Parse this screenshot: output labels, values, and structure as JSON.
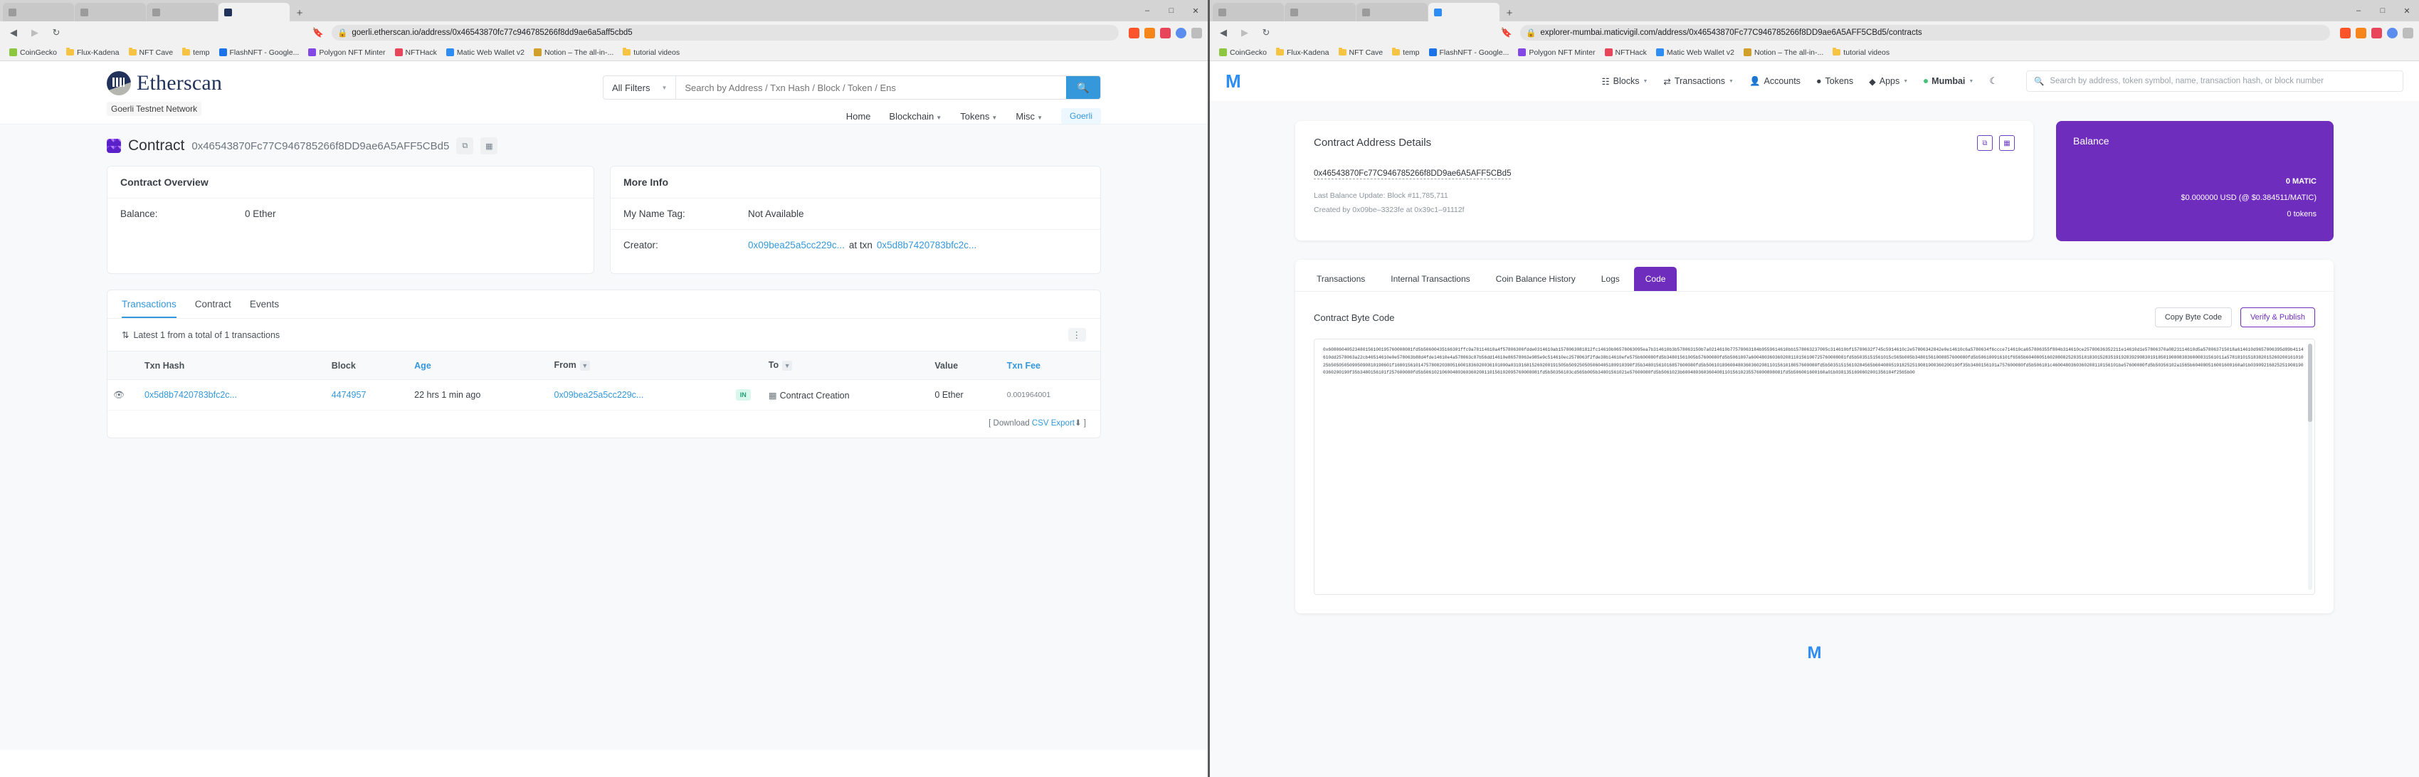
{
  "left_browser": {
    "tabs": [
      {
        "label": "",
        "color": "#8e8e8e"
      },
      {
        "label": "",
        "color": "#8e8e8e"
      },
      {
        "label": "",
        "color": "#8e8e8e"
      },
      {
        "label": "",
        "color": "#8e8e8e"
      }
    ],
    "url": "goerli.etherscan.io/address/0x46543870fc77c946785266f8dd9ae6a5aff5cbd5",
    "lock_icon": "lock-icon",
    "back_icon": "back-arrow-icon",
    "forward_icon": "forward-arrow-icon",
    "reload_icon": "reload-icon",
    "bookmark_star_icon": "bookmark-icon",
    "bookmarks": [
      {
        "label": "CoinGecko",
        "type": "site",
        "color": "#8dc63f"
      },
      {
        "label": "Flux-Kadena",
        "type": "folder"
      },
      {
        "label": "NFT Cave",
        "type": "folder"
      },
      {
        "label": "temp",
        "type": "folder"
      },
      {
        "label": "FlashNFT - Google...",
        "type": "site",
        "color": "#1a73e8"
      },
      {
        "label": "Polygon NFT Minter",
        "type": "site",
        "color": "#8247e5"
      },
      {
        "label": "NFTHack",
        "type": "site",
        "color": "#e8455b"
      },
      {
        "label": "Matic Web Wallet v2",
        "type": "site",
        "color": "#2e8df5"
      },
      {
        "label": "Notion – The all-in-...",
        "type": "site",
        "color": "#d0a02a"
      },
      {
        "label": "tutorial videos",
        "type": "folder"
      }
    ]
  },
  "etherscan": {
    "brand": "Etherscan",
    "network_badge": "Goerli Testnet Network",
    "search": {
      "filter_label": "All Filters",
      "placeholder": "Search by Address / Txn Hash / Block / Token / Ens",
      "value": "",
      "button_icon": "search-icon"
    },
    "nav": [
      {
        "label": "Home",
        "has_caret": false
      },
      {
        "label": "Blockchain",
        "has_caret": true
      },
      {
        "label": "Tokens",
        "has_caret": true
      },
      {
        "label": "Misc",
        "has_caret": true
      }
    ],
    "network_pill": "Goerli",
    "page": {
      "kind_label": "Contract",
      "address": "0x46543870Fc77C946785266f8DD9ae6A5AFF5CBd5",
      "copy_icon": "copy-icon",
      "qr_icon": "qr-code-icon"
    },
    "contract_overview": {
      "title": "Contract Overview",
      "rows": [
        {
          "label": "Balance:",
          "value": "0 Ether"
        }
      ]
    },
    "more_info": {
      "title": "More Info",
      "rows": [
        {
          "label": "My Name Tag:",
          "value": "Not Available",
          "link": false
        },
        {
          "label": "Creator:",
          "value": "0x09bea25a5cc229c...",
          "mid": "at txn",
          "value2": "0x5d8b7420783bfc2c...",
          "link": true
        }
      ]
    },
    "tabs": [
      {
        "label": "Transactions",
        "active": true
      },
      {
        "label": "Contract",
        "active": false
      },
      {
        "label": "Events",
        "active": false
      }
    ],
    "subbar": {
      "sort_icon": "sort-icon",
      "text": "Latest 1 from a total of 1 transactions",
      "kebab_icon": "kebab-menu-icon"
    },
    "table": {
      "columns": [
        "",
        "Txn Hash",
        "Block",
        "Age",
        "From",
        "",
        "To",
        "Value",
        "Txn Fee"
      ],
      "sortable_columns": [
        "Age",
        "Txn Fee"
      ],
      "filter_columns": [
        "From",
        "To"
      ],
      "rows": [
        {
          "eye_icon": "eye-icon",
          "txn_hash": "0x5d8b7420783bfc2c...",
          "block": "4474957",
          "age": "22 hrs 1 min ago",
          "from": "0x09bea25a5cc229c...",
          "direction": "IN",
          "to_icon": "contract-icon",
          "to": "Contract Creation",
          "value": "0 Ether",
          "txn_fee": "0.001964001"
        }
      ]
    },
    "footer": {
      "prefix": "[ Download ",
      "link": "CSV Export",
      "icon": "download-icon",
      "suffix": " ]"
    }
  },
  "right_browser": {
    "url": "explorer-mumbai.maticvigil.com/address/0x46543870Fc77C946785266f8DD9ae6A5AFF5CBd5/contracts",
    "lock_icon": "lock-icon",
    "bookmarks": [
      {
        "label": "CoinGecko",
        "type": "site",
        "color": "#8dc63f"
      },
      {
        "label": "Flux-Kadena",
        "type": "folder"
      },
      {
        "label": "NFT Cave",
        "type": "folder"
      },
      {
        "label": "temp",
        "type": "folder"
      },
      {
        "label": "FlashNFT - Google...",
        "type": "site",
        "color": "#1a73e8"
      },
      {
        "label": "Polygon NFT Minter",
        "type": "site",
        "color": "#8247e5"
      },
      {
        "label": "NFTHack",
        "type": "site",
        "color": "#e8455b"
      },
      {
        "label": "Matic Web Wallet v2",
        "type": "site",
        "color": "#2e8df5"
      },
      {
        "label": "Notion – The all-in-...",
        "type": "site",
        "color": "#d0a02a"
      },
      {
        "label": "tutorial videos",
        "type": "folder"
      }
    ]
  },
  "polygonscan": {
    "logo": "M",
    "nav": [
      {
        "label": "Blocks",
        "icon": "blocks-icon",
        "caret": true
      },
      {
        "label": "Transactions",
        "icon": "transactions-icon",
        "caret": true
      },
      {
        "label": "Accounts",
        "icon": "accounts-icon",
        "caret": false
      },
      {
        "label": "Tokens",
        "icon": "tokens-icon",
        "caret": false
      },
      {
        "label": "Apps",
        "icon": "apps-icon",
        "caret": true
      },
      {
        "label": "Mumbai",
        "icon": "network-dot-icon",
        "caret": true
      }
    ],
    "theme_icon": "moon-icon",
    "search": {
      "placeholder": "Search by address, token symbol, name, transaction hash, or block number",
      "icon": "search-icon"
    },
    "details": {
      "title": "Contract Address Details",
      "copy_icon": "copy-icon",
      "qr_icon": "qr-code-icon",
      "address": "0x46543870Fc77C946785266f8DD9ae6A5AFF5CBd5",
      "last_balance_update": "Last Balance Update: Block #11,785,711",
      "created_by": "Created by 0x09be–3323fe at 0x39c1–91112f"
    },
    "balance": {
      "title": "Balance",
      "amount": "0 MATIC",
      "usd": "$0.000000 USD (@ $0.384511/MATIC)",
      "tokens": "0 tokens",
      "bg_color": "#6f2dbd"
    },
    "tabs": [
      {
        "label": "Transactions",
        "active": false
      },
      {
        "label": "Internal Transactions",
        "active": false
      },
      {
        "label": "Coin Balance History",
        "active": false
      },
      {
        "label": "Logs",
        "active": false
      },
      {
        "label": "Code",
        "active": true
      }
    ],
    "code_panel": {
      "title": "Contract Byte Code",
      "copy_button": "Copy Byte Code",
      "verify_button": "Verify & Publish",
      "bytecode": "0x60806040523480156100195760008081fd5b50600435166301ffc9a78114610a4f57806306fdde0314610ab1578063081812fc14610b06578063095ea7b314610b3b578063150b7a0214610b77578063184b9559614610bb1578063237005c314610bf15780632f745c5914610c2e57806342842e0e14610c6a5780634f6ccce714610ca657806355f804b314610ce25780636352211e14610d1e57806370a0823114610d5a578063715018a614610d9657806395d89b4114610dd2578063a22cb46514610e0e578063b88d4fde14610e4a578063c87b56dd14610e86578063e985e9c514610ec2578063f2fde38b14610efe575b600080fd5b34801561005b57600080fd5b5061007a600480360360208110156100725760008081fd5b5035151561015c565b005b34801561008857600080fd5b506100916101f6565b604080516020808252835181830152835191928392908301918501908083836000831561011a5781810151838201526020016101025b50505050905090810190601f1680156101475780820380516001836020036101000a031916815260200191505b509250505060405180910390f35b34801561016857600080fd5b506101896004803603602081101561018057600080fd5b50351515610284565b60408051918252519081900360200190f35b3480156101a757600080fd5b506101c4600480360360208110156101be57600080fd5b50356102a1565b604080516001600160a01b039092168252519081900360200190f35b3480156101f257600080fd5b50610210600480360360208110156102095760008081fd5b50356103cd565b005b34801561021e57600080fd5b5061023b60048036036040811015610235576000808081fd5b506001600160a01b0381351690602001356104f2565b00"
    },
    "footer_logo": "M"
  }
}
